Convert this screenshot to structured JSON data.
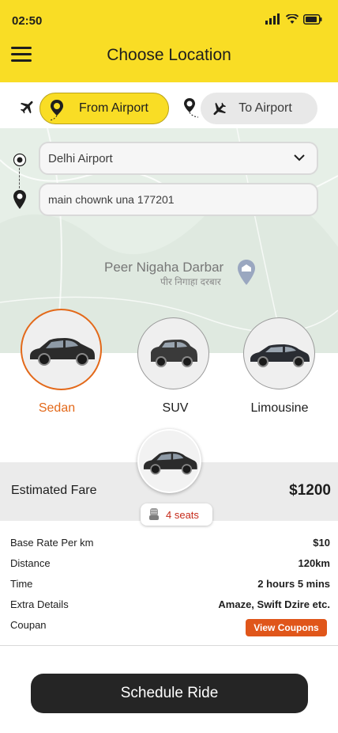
{
  "status_bar": {
    "time": "02:50",
    "icons": [
      "signal-icon",
      "wifi-icon",
      "battery-icon"
    ]
  },
  "header": {
    "title": "Choose Location",
    "menu_icon": "hamburger-menu-icon",
    "background": "#f9dd25"
  },
  "trip_toggle": {
    "from_airport": {
      "label": "From Airport",
      "selected": true
    },
    "to_airport": {
      "label": "To Airport",
      "selected": false
    }
  },
  "locations": {
    "pickup": "Delhi Airport",
    "drop": "main chownk una 177201"
  },
  "map": {
    "place_name": "Peer Nigaha Darbar",
    "place_name_hindi": "पीर निगाहा दरबार"
  },
  "car_types": [
    {
      "label": "Sedan",
      "selected": true
    },
    {
      "label": "SUV",
      "selected": false
    },
    {
      "label": "Limousine",
      "selected": false
    }
  ],
  "fare": {
    "label": "Estimated Fare",
    "value": "$1200",
    "seats": "4 seats"
  },
  "details": [
    {
      "key": "Base Rate Per km",
      "value": "$10"
    },
    {
      "key": "Distance",
      "value": "120km"
    },
    {
      "key": "Time",
      "value": "2 hours 5 mins"
    },
    {
      "key": "Extra Details",
      "value": "Amaze, Swift Dzire etc."
    }
  ],
  "coupon": {
    "label": "Coupan",
    "button": "View Coupons"
  },
  "schedule_button": "Schedule Ride",
  "colors": {
    "accent": "#f9dd25",
    "selected": "#e3691a",
    "coupon": "#e0561a",
    "primary_button": "#252525"
  }
}
